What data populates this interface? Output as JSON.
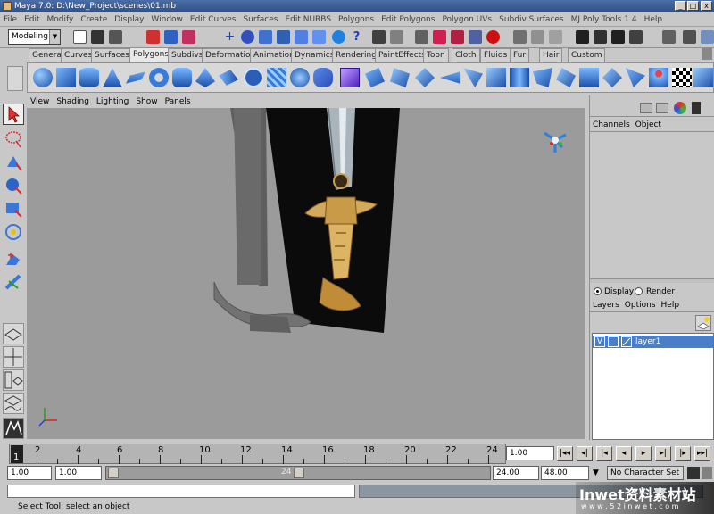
{
  "window": {
    "title": "Maya 7.0: D:\\New_Project\\scenes\\01.mb",
    "min": "_",
    "max": "□",
    "close": "x"
  },
  "menubar": [
    "File",
    "Edit",
    "Modify",
    "Create",
    "Display",
    "Window",
    "Edit Curves",
    "Surfaces",
    "Edit NURBS",
    "Polygons",
    "Edit Polygons",
    "Polygon UVs",
    "Subdiv Surfaces",
    "MJ Poly Tools 1.4",
    "Help"
  ],
  "statusline": {
    "mode": "Modeling"
  },
  "shelf_tabs": [
    "General",
    "Curves",
    "Surfaces",
    "Polygons",
    "Subdivs",
    "Deformation",
    "Animation",
    "Dynamics",
    "Rendering",
    "PaintEffects",
    "Toon",
    "Cloth",
    "Fluids",
    "Fur",
    "Hair",
    "Custom"
  ],
  "shelf_active": "Polygons",
  "panel_menu": [
    "View",
    "Shading",
    "Lighting",
    "Show",
    "Panels"
  ],
  "channel_box": {
    "menu": [
      "Channels",
      "Object"
    ]
  },
  "layer_editor": {
    "display_label": "Display",
    "render_label": "Render",
    "menu": [
      "Layers",
      "Options",
      "Help"
    ],
    "layer": {
      "visibility": "V",
      "name": "layer1"
    }
  },
  "timeline": {
    "ticks": [
      "2",
      "4",
      "6",
      "8",
      "10",
      "12",
      "14",
      "16",
      "18",
      "20",
      "22",
      "24"
    ],
    "current_frame_marker": "1",
    "current_time": "1.00"
  },
  "range": {
    "start": "1.00",
    "inner_start": "1.00",
    "slider_end_label": "24",
    "end": "24.00",
    "total_end": "48.00",
    "character_set": "No Character Set"
  },
  "help_line": "Select Tool: select an object",
  "watermark": {
    "brand": "Inwet资料素材站",
    "url": "w w w . 5 2 i n w e t . c o m"
  },
  "colors": {
    "title_bar": "#3a5b94",
    "viewport_bg": "#9b9b9b",
    "selection_blue": "#3670b8",
    "layer_row": "#4a7ec8"
  }
}
